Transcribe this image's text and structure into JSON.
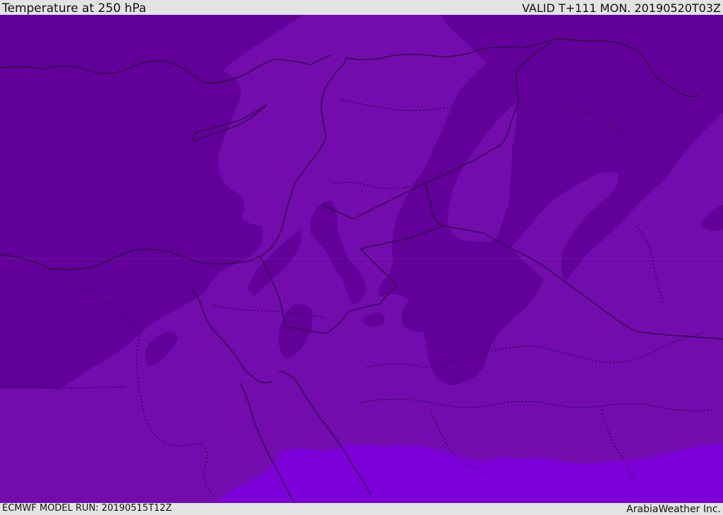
{
  "header": {
    "title": "Temperature at 250 hPa",
    "valid": "VALID T+111 MON. 20190520T03Z"
  },
  "footer": {
    "model_run": "ECMWF MODEL RUN: 20190515T12Z",
    "credit": "ArabiaWeather Inc."
  },
  "map": {
    "field": "temperature",
    "level": "250 hPa",
    "colors": {
      "cold": "#62009a",
      "mid": "#720cad",
      "warm": "#7c00d8",
      "border": "#1a0026"
    }
  }
}
